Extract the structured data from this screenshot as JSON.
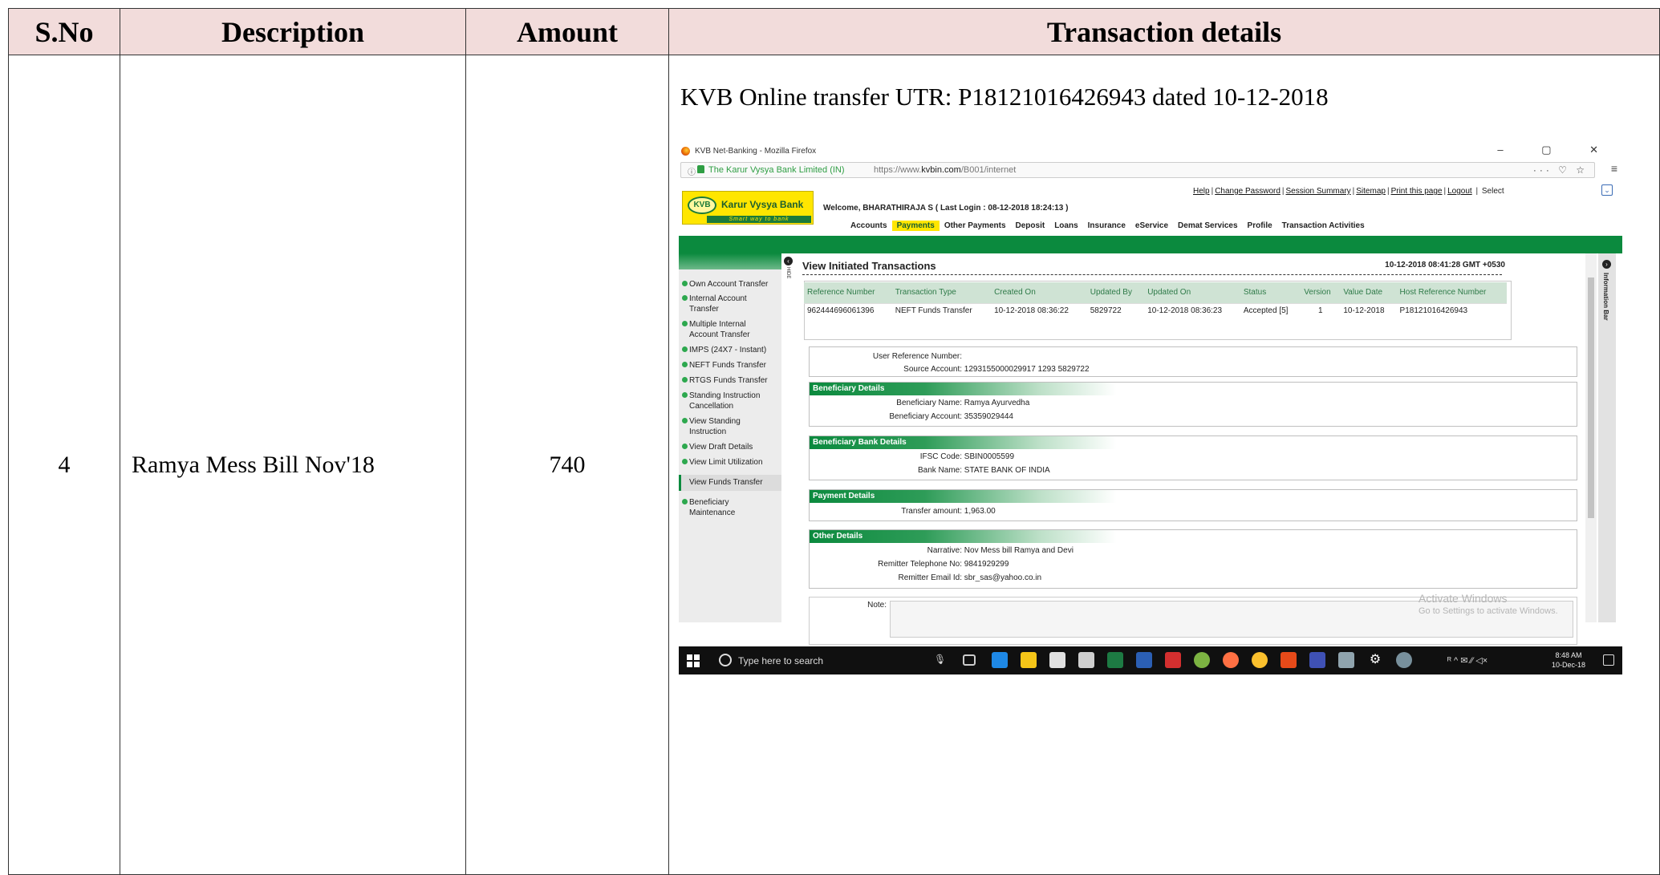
{
  "table": {
    "headers": {
      "sno": "S.No",
      "description": "Description",
      "amount": "Amount",
      "details": "Transaction details"
    },
    "row": {
      "sno": "4",
      "description": "Ramya Mess Bill Nov'18",
      "amount": "740",
      "caption": "KVB Online transfer UTR: P18121016426943 dated 10-12-2018"
    }
  },
  "screenshot": {
    "window_title": "KVB Net-Banking - Mozilla Firefox",
    "window_controls": "– ▢ ✕",
    "url_site": "The Karur Vysya Bank Limited (IN)",
    "url_prefix": "https://www.",
    "url_domain": "kvbin.com",
    "url_path": "/B001/internet",
    "url_actions": "··· ♡ ☆",
    "menu_icon": "≡",
    "top_links": [
      "Help",
      "Change Password",
      "Session Summary",
      "Sitemap",
      "Print this page",
      "Logout"
    ],
    "top_links_select": "Select",
    "logo": {
      "ring": "KVB",
      "name": "Karur Vysya Bank",
      "tagline": "Smart way to bank"
    },
    "welcome": "Welcome, BHARATHIRAJA S    ( Last Login : 08-12-2018 18:24:13 )",
    "nav": [
      "Accounts",
      "Payments",
      "Other Payments",
      "Deposit",
      "Loans",
      "Insurance",
      "eService",
      "Demat Services",
      "Profile",
      "Transaction Activities"
    ],
    "sidebar": [
      {
        "l1": "Own Account Transfer",
        "l2": ""
      },
      {
        "l1": "Internal Account",
        "l2": "Transfer"
      },
      {
        "l1": "Multiple Internal",
        "l2": "Account Transfer"
      },
      {
        "l1": "IMPS (24X7 - Instant)",
        "l2": ""
      },
      {
        "l1": "NEFT Funds Transfer",
        "l2": ""
      },
      {
        "l1": "RTGS Funds Transfer",
        "l2": ""
      },
      {
        "l1": "Standing Instruction",
        "l2": "Cancellation"
      },
      {
        "l1": "View Standing",
        "l2": "Instruction"
      },
      {
        "l1": "View Draft Details",
        "l2": ""
      },
      {
        "l1": "View Limit Utilization",
        "l2": ""
      }
    ],
    "sidebar_active": "View Funds Transfer",
    "sidebar_last": {
      "l1": "Beneficiary",
      "l2": "Maintenance"
    },
    "hide_label": "HIDE",
    "page_title": "View Initiated Transactions",
    "page_time": "10-12-2018 08:41:28 GMT +0530",
    "txn_headers": [
      "Reference Number",
      "Transaction Type",
      "Created On",
      "Updated By",
      "Updated On",
      "Status",
      "Version",
      "Value Date",
      "Host Reference Number"
    ],
    "txn_row": {
      "ref": "962444696061396",
      "type": "NEFT Funds Transfer",
      "created": "10-12-2018 08:36:22",
      "updated_by": "5829722",
      "updated_on": "10-12-2018 08:36:23",
      "status": "Accepted [5]",
      "version": "1",
      "value_date": "10-12-2018",
      "host_ref": "P18121016426943"
    },
    "user_ref_label": "User Reference Number:",
    "source_label": "Source Account:",
    "source_value": "1293155000029917 1293 5829722",
    "beneficiary": {
      "title": "Beneficiary Details",
      "name_label": "Beneficiary Name:",
      "name": "Ramya Ayurvedha",
      "acct_label": "Beneficiary Account:",
      "acct": "35359029444"
    },
    "bank": {
      "title": "Beneficiary Bank Details",
      "ifsc_label": "IFSC Code:",
      "ifsc": "SBIN0005599",
      "bank_label": "Bank Name:",
      "bank": "STATE BANK OF INDIA"
    },
    "payment": {
      "title": "Payment Details",
      "amount_label": "Transfer amount:",
      "amount": "1,963.00"
    },
    "other": {
      "title": "Other Details",
      "narr_label": "Narrative:",
      "narr": "Nov Mess bill Ramya and Devi",
      "tel_label": "Remitter Telephone No:",
      "tel": "9841929299",
      "email_label": "Remitter Email Id:",
      "email": "sbr_sas@yahoo.co.in"
    },
    "note_label": "Note:",
    "info_bar": "Information Bar",
    "activate": {
      "line1": "Activate Windows",
      "line2": "Go to Settings to activate Windows."
    },
    "taskbar": {
      "search": "Type here to search",
      "tray": "ᴿ ^ ✉ ⁄⁄ ◁×",
      "time": "8:48 AM",
      "date": "10-Dec-18"
    }
  }
}
